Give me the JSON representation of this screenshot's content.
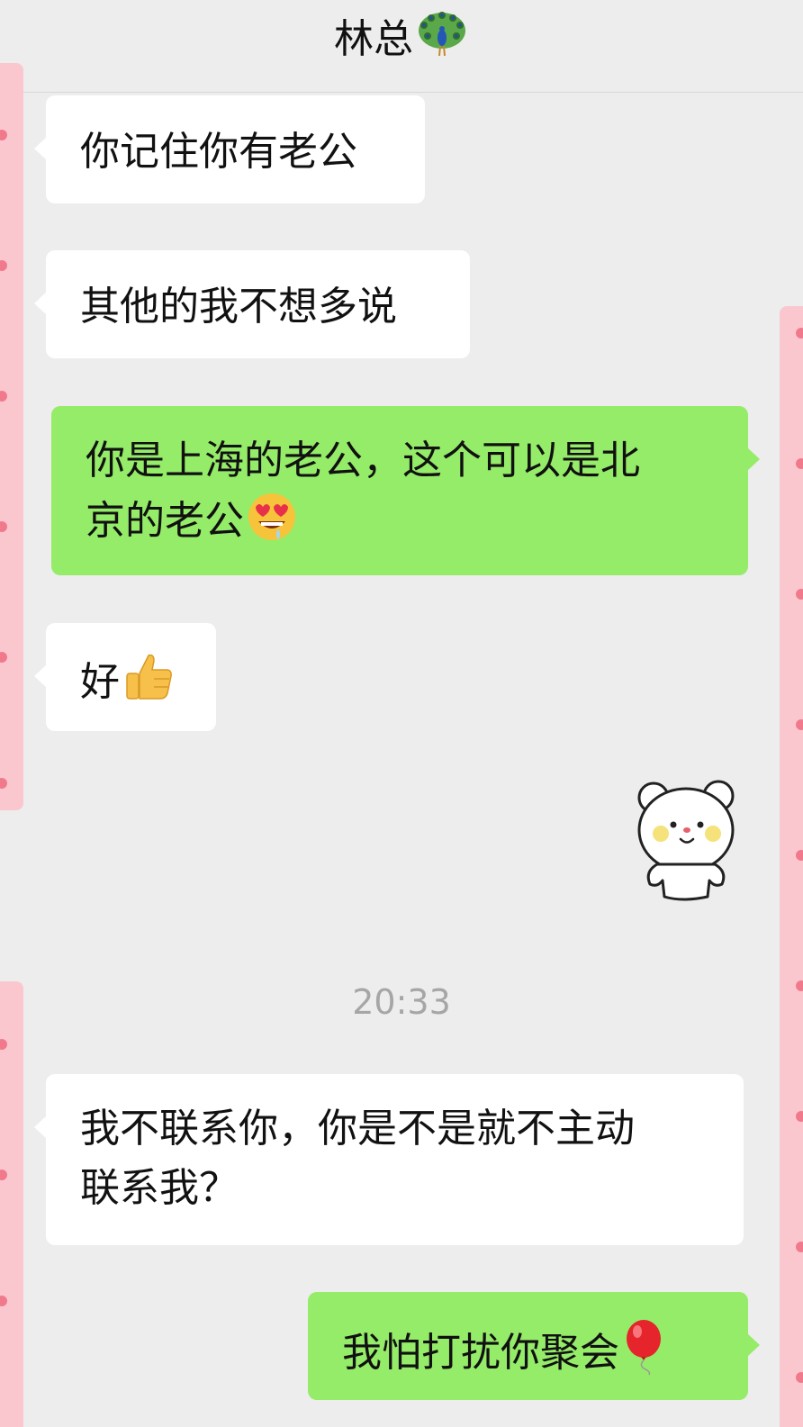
{
  "header": {
    "title": "林总",
    "title_emoji": "peacock-icon"
  },
  "messages": [
    {
      "side": "in",
      "text": "你记住你有老公"
    },
    {
      "side": "in",
      "text": "其他的我不想多说"
    },
    {
      "side": "out",
      "text_line1": "你是上海的老公，这个可以是北",
      "text_line2": "京的老公",
      "emoji": "heart-eyes-drool-icon"
    },
    {
      "side": "in",
      "text": "好",
      "emoji": "thumbs-up-icon"
    },
    {
      "side": "out",
      "type": "sticker",
      "sticker": "white-bear-sticker"
    },
    {
      "side": "in",
      "text_line1": "我不联系你，你是不是就不主动",
      "text_line2": "联系我？"
    },
    {
      "side": "out",
      "text": "我怕打扰你聚会",
      "emoji": "red-balloon-icon"
    }
  ],
  "timestamp": "20:33",
  "colors": {
    "background": "#ededed",
    "incoming_bubble": "#ffffff",
    "outgoing_bubble": "#95ec69",
    "redaction_pink": "#fbc7cf",
    "timestamp_text": "#a6a6a6"
  }
}
